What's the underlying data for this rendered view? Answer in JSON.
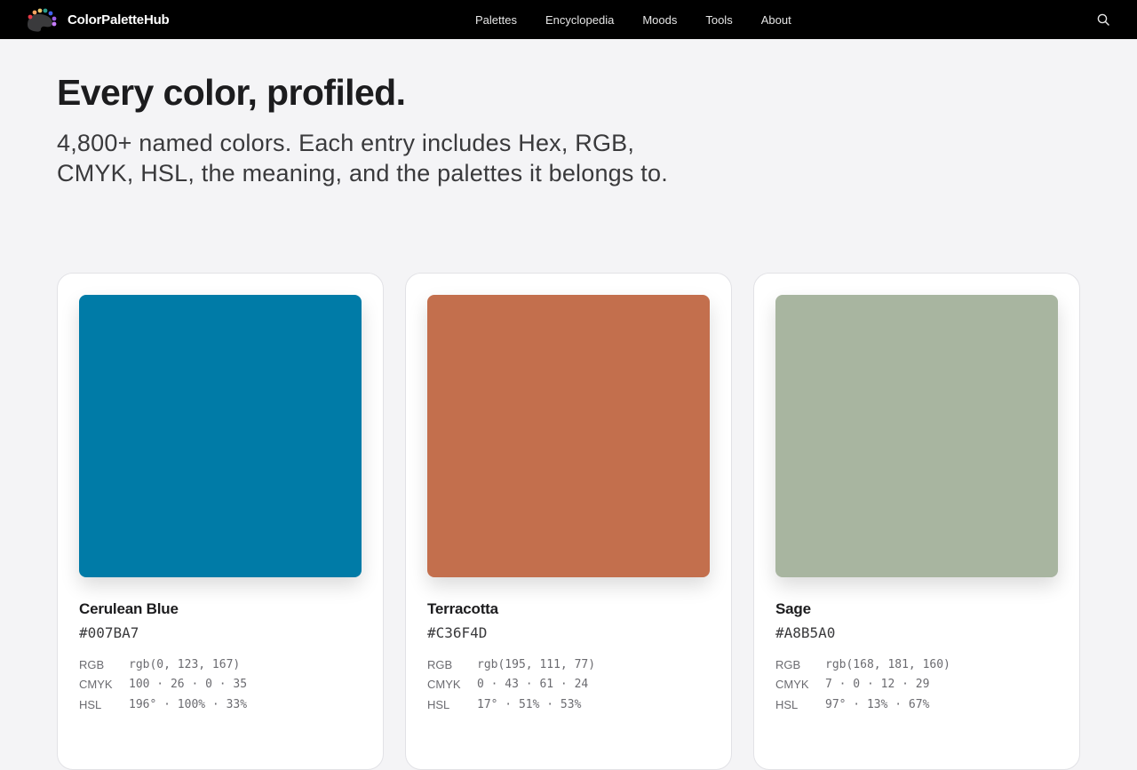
{
  "header": {
    "brand": "ColorPaletteHub",
    "nav": [
      "Palettes",
      "Encyclopedia",
      "Moods",
      "Tools",
      "About"
    ],
    "search_icon": "search-icon"
  },
  "hero": {
    "title": "Every color, profiled.",
    "subtitle": "4,800+ named colors. Each entry includes Hex, RGB, CMYK, HSL, the meaning, and the palettes it belongs to."
  },
  "colors": [
    {
      "name": "Cerulean Blue",
      "hex": "#007BA7",
      "rgb": "rgb(0, 123, 167)",
      "cmyk": "100 · 26 · 0 · 35",
      "hsl": "196° · 100% · 33%"
    },
    {
      "name": "Terracotta",
      "hex": "#C36F4D",
      "rgb": "rgb(195, 111, 77)",
      "cmyk": "0 · 43 · 61 · 24",
      "hsl": "17° · 51% · 53%"
    },
    {
      "name": "Sage",
      "hex": "#A8B5A0",
      "rgb": "rgb(168, 181, 160)",
      "cmyk": "7 · 0 · 12 · 29",
      "hsl": "97° · 13% · 67%"
    }
  ],
  "spec_labels": {
    "rgb": "RGB",
    "cmyk": "CMYK",
    "hsl": "HSL"
  }
}
